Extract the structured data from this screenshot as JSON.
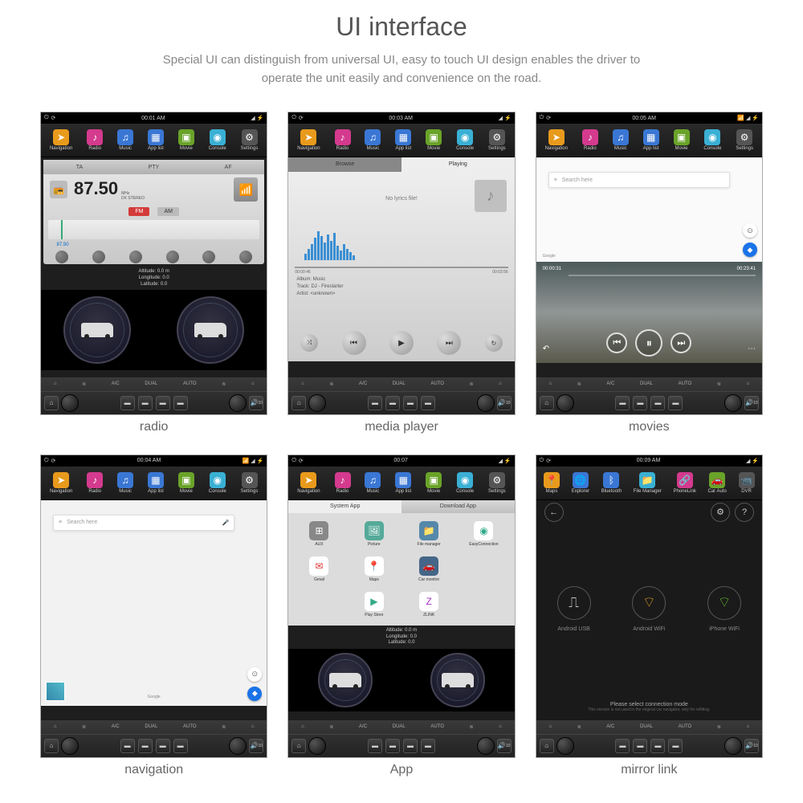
{
  "page_title": "UI interface",
  "page_subtitle_1": "Special UI can distinguish from universal UI, easy to touch UI design enables the driver to",
  "page_subtitle_2": "operate the unit easily and convenience on the road.",
  "nav_items": [
    "Navigation",
    "Radio",
    "Music",
    "App list",
    "Movie",
    "Console",
    "Settings"
  ],
  "nav_items_mirror": [
    "Maps",
    "Explorer",
    "Bluetooth",
    "File Manager",
    "PhoneLink",
    "Car Auto",
    "DVR"
  ],
  "hw_labels": [
    "A/C",
    "DUAL",
    "AUTO"
  ],
  "vol_label": "10",
  "screens": {
    "radio": {
      "time": "00:01 AM",
      "caption": "radio",
      "tabs": [
        "TA",
        "PTY",
        "AF"
      ],
      "freq": "87.50",
      "freq_units": "MHz",
      "stereo": "DX STEREO",
      "fm": "FM",
      "am": "AM",
      "preset": "87.50",
      "gps": {
        "alt": "Altitude: 0.0 m",
        "lon": "Longitude: 0.0",
        "lat": "Latitude: 0.0"
      }
    },
    "media": {
      "time": "00:03 AM",
      "caption": "media player",
      "tab_browse": "Browse",
      "tab_playing": "Playing",
      "nolyrics": "No lyrics file!",
      "pos": "00:00:46",
      "dur": "00:03:56",
      "album_l": "Album:",
      "album_v": "Music",
      "track_l": "Track:",
      "track_v": "DJ - Firestarter",
      "artist_l": "Artist:",
      "artist_v": "<unknown>"
    },
    "movies": {
      "time": "00:05 AM",
      "caption": "movies",
      "search": "Search here",
      "google": "Google",
      "vid_pos": "00:00:31",
      "vid_dur": "00:23:41"
    },
    "nav": {
      "time": "00:04 AM",
      "caption": "navigation",
      "search": "Search here",
      "google": "Google"
    },
    "app": {
      "time": "00:07",
      "caption": "App",
      "tab_sys": "System App",
      "tab_dl": "Download App",
      "apps": [
        "AUX",
        "Picture",
        "File manager",
        "EasyConnection",
        "Gmail",
        "Maps",
        "Car monitor",
        "",
        "",
        "Play Store",
        "ZLINK",
        ""
      ],
      "gps": {
        "alt": "Altitude: 0.0 m",
        "lon": "Longitude: 0.0",
        "lat": "Latitude: 0.0"
      }
    },
    "mirror": {
      "time": "00:09 AM",
      "caption": "mirror link",
      "opt1": "Android USB",
      "opt2": "Android WiFi",
      "opt3": "iPhone WiFi",
      "prompt": "Please select connection mode",
      "note": "This version is not used in the original car navigator, only for refitting."
    }
  }
}
